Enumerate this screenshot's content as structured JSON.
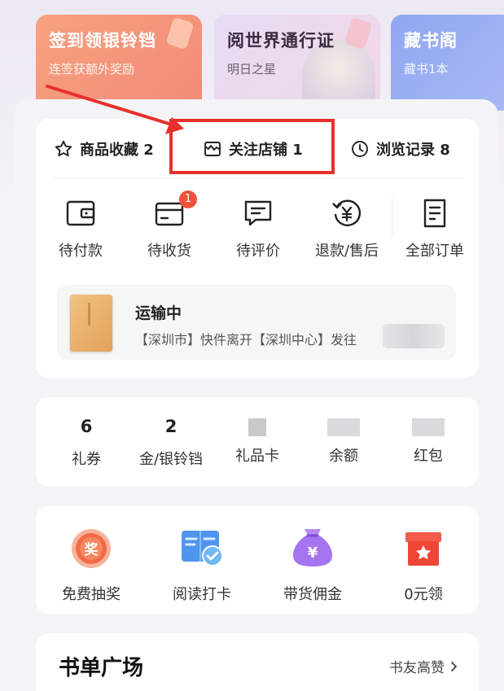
{
  "promos": [
    {
      "title": "签到领银铃铛",
      "subtitle": "连签获额外奖励"
    },
    {
      "title": "阅世界通行证",
      "subtitle": "明日之星"
    },
    {
      "title": "藏书阁",
      "subtitle": "藏书1本"
    }
  ],
  "quick_links": [
    {
      "label": "商品收藏 2",
      "icon": "star-icon"
    },
    {
      "label": "关注店铺 1",
      "icon": "store-icon"
    },
    {
      "label": "浏览记录 8",
      "icon": "clock-icon"
    }
  ],
  "orders": [
    {
      "label": "待付款",
      "icon": "wallet-icon"
    },
    {
      "label": "待收货",
      "icon": "card-icon",
      "badge": "1"
    },
    {
      "label": "待评价",
      "icon": "comment-icon"
    },
    {
      "label": "退款/售后",
      "icon": "refund-icon"
    },
    {
      "label": "全部订单",
      "icon": "document-icon"
    }
  ],
  "shipment": {
    "status": "运输中",
    "detail": "【深圳市】快件离开【深圳中心】发往"
  },
  "assets": [
    {
      "value": "6",
      "label": "礼券"
    },
    {
      "value": "2",
      "label": "金/银铃铛"
    },
    {
      "value": "",
      "label": "礼品卡"
    },
    {
      "value": "",
      "label": "余额"
    },
    {
      "value": "",
      "label": "红包"
    }
  ],
  "services": [
    {
      "label": "免费抽奖",
      "icon": "lottery-icon",
      "glyph": "奖"
    },
    {
      "label": "阅读打卡",
      "icon": "reading-checkin-icon"
    },
    {
      "label": "带货佣金",
      "icon": "money-bag-icon",
      "glyph": "¥"
    },
    {
      "label": "0元领",
      "icon": "gift-box-icon"
    }
  ],
  "booklist": {
    "title": "书单广场",
    "more": "书友高赞"
  },
  "colors": {
    "accent_red": "#e8302c",
    "badge": "#f0513a",
    "promo1": "#f6a27f",
    "promo3": "#8fa7f1"
  }
}
